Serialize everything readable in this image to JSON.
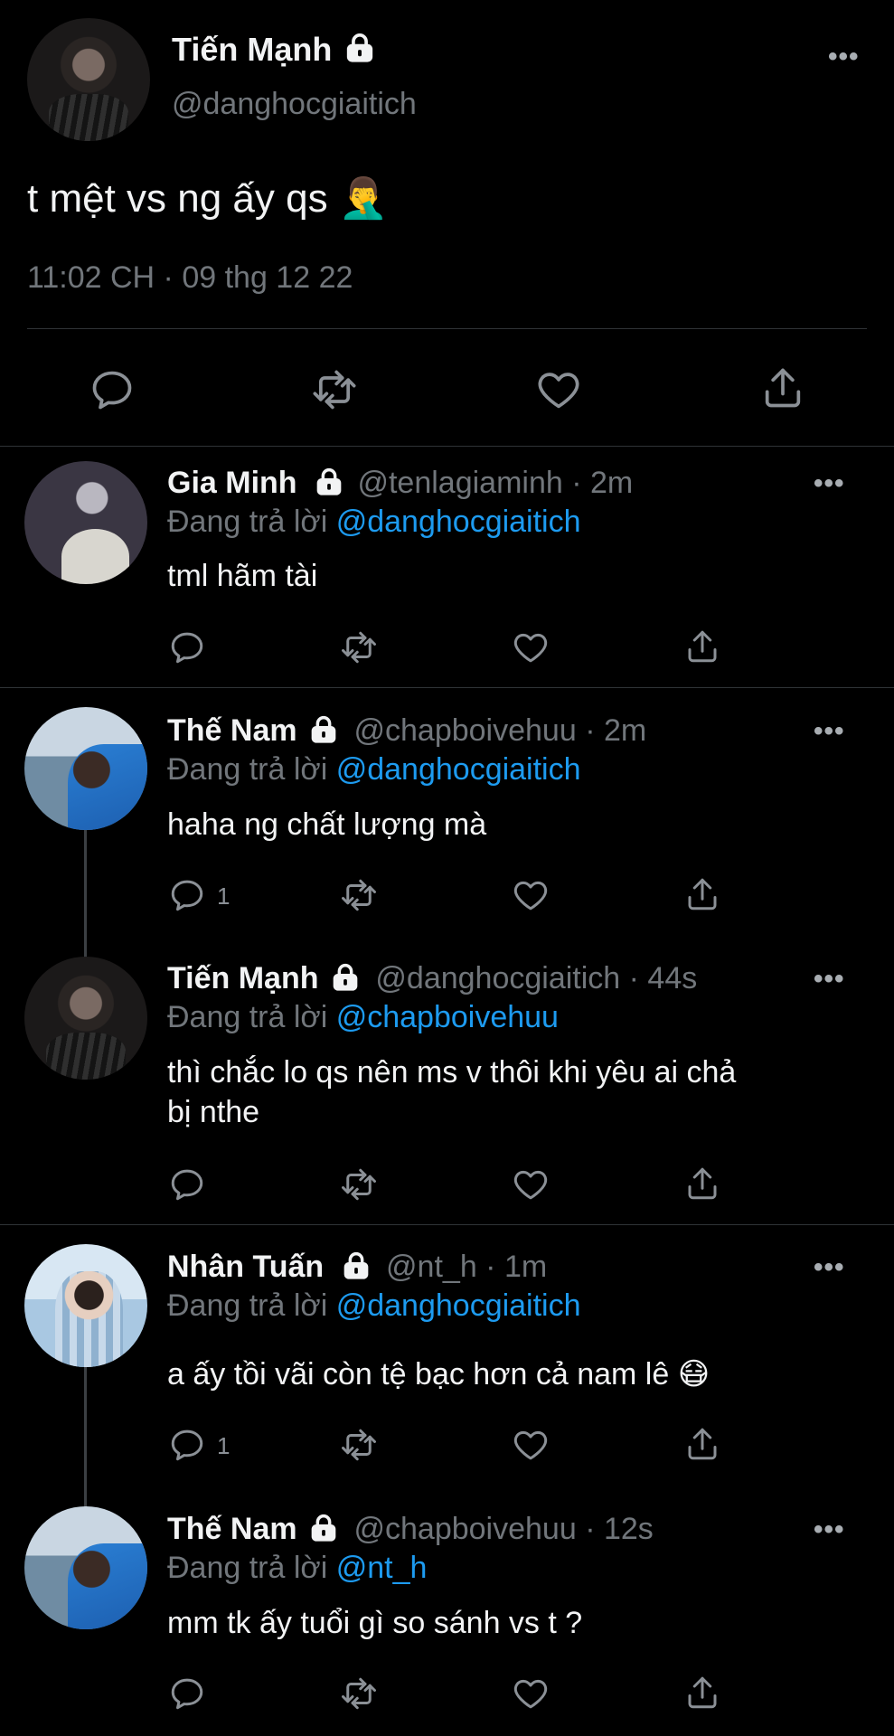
{
  "main_tweet": {
    "name": "Tiến Mạnh",
    "handle": "@danghocgiaitich",
    "text": "t mệt vs ng ấy qs 🤦‍♂️",
    "timestamp": "11:02 CH · 09 thg 12 22",
    "avatar": "tien-manh-avatar"
  },
  "replies": [
    {
      "name": "Gia Minh",
      "handle_time": "@tenlagiaminh · 2m",
      "replying_label": "Đang trả lời",
      "replying_to": "@danghocgiaitich",
      "text": "tml hãm tài",
      "reply_count": ""
    },
    {
      "name": "Thế Nam",
      "handle_time": "@chapboivehuu · 2m",
      "replying_label": "Đang trả lời",
      "replying_to": "@danghocgiaitich",
      "text": "haha ng chất lượng mà",
      "reply_count": "1"
    },
    {
      "name": "Tiến Mạnh",
      "handle_time": "@danghocgiaitich · 44s",
      "replying_label": "Đang trả lời",
      "replying_to": "@chapboivehuu",
      "text_line1": "thì chắc lo qs nên ms v thôi khi yêu ai chả",
      "text_line2": "bị nthe",
      "reply_count": ""
    },
    {
      "name": "Nhân Tuấn",
      "handle_time": "@nt_h · 1m",
      "replying_label": "Đang trả lời",
      "replying_to": "@danghocgiaitich",
      "text": "a ấy tồi vãi còn tệ bạc hơn cả nam lê 😷",
      "reply_count": "1"
    },
    {
      "name": "Thế Nam",
      "handle_time": "@chapboivehuu · 12s",
      "replying_label": "Đang trả lời",
      "replying_to": "@nt_h",
      "text": "mm tk ấy tuổi gì so sánh vs t ?",
      "reply_count": ""
    }
  ],
  "more_label": "•••",
  "colors": {
    "background": "#000000",
    "accent": "#1d9bf0",
    "secondary_text": "#71767b"
  }
}
